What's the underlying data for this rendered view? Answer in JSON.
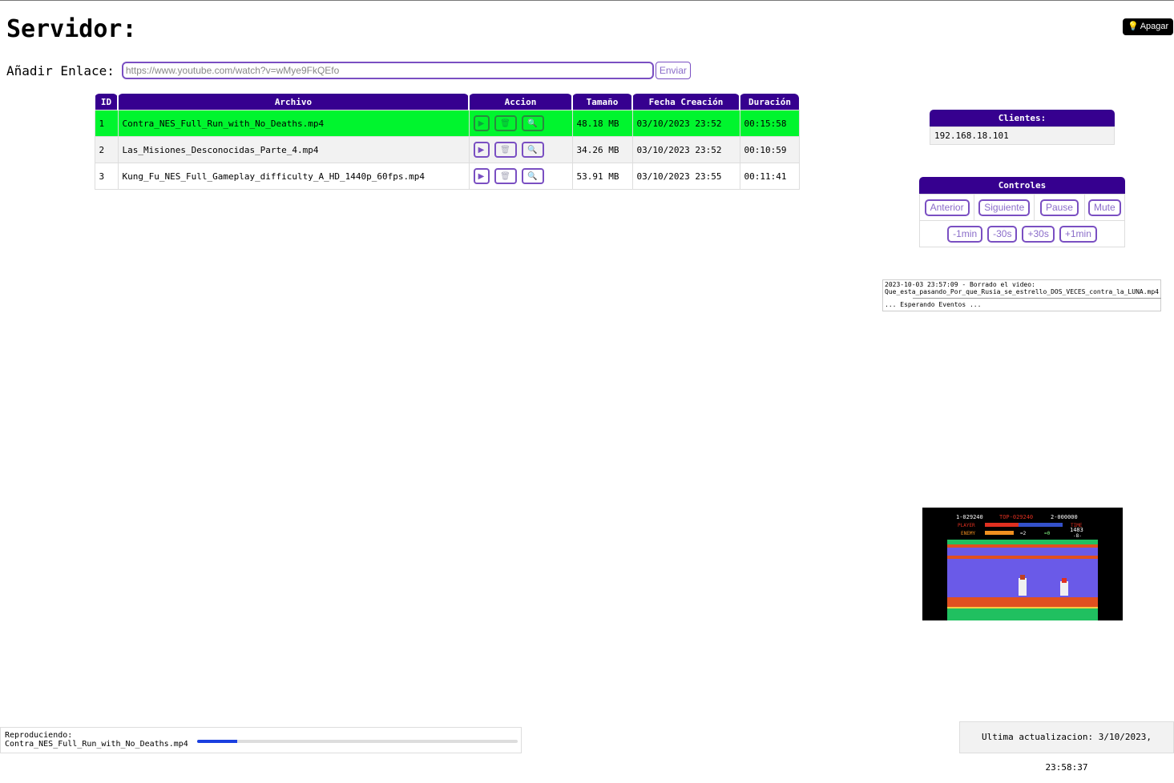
{
  "header": {
    "title": "Servidor:",
    "power_button": "Apagar",
    "power_icon": "lightbulb-icon"
  },
  "link_form": {
    "label": "Añadir Enlace:",
    "placeholder": "https://www.youtube.com/watch?v=wMye9FkQEfo",
    "submit_label": "Enviar"
  },
  "files_table": {
    "headers": [
      "ID",
      "Archivo",
      "Accion",
      "Tamaño",
      "Fecha Creación",
      "Duración"
    ],
    "rows": [
      {
        "id": "1",
        "file": "Contra_NES_Full_Run_with_No_Deaths.mp4",
        "size": "48.18 MB",
        "created": "03/10/2023 23:52",
        "duration": "00:15:58",
        "playing": true
      },
      {
        "id": "2",
        "file": "Las_Misiones_Desconocidas_Parte_4.mp4",
        "size": "34.26 MB",
        "created": "03/10/2023 23:52",
        "duration": "00:10:59",
        "playing": false
      },
      {
        "id": "3",
        "file": "Kung_Fu_NES_Full_Gameplay_difficulty_A_HD_1440p_60fps.mp4",
        "size": "53.91 MB",
        "created": "03/10/2023 23:55",
        "duration": "00:11:41",
        "playing": false
      }
    ],
    "action_icons": [
      "play-icon",
      "trash-icon",
      "magnifier-icon"
    ]
  },
  "clients": {
    "title": "Clientes:",
    "items": [
      "192.168.18.101"
    ]
  },
  "controls": {
    "title": "Controles",
    "row1": [
      "Anterior",
      "Siguiente",
      "Pause",
      "Mute"
    ],
    "row2": [
      "-1min",
      "-30s",
      "+30s",
      "+1min"
    ]
  },
  "log": {
    "entry_line1": "2023-10-03 23:57:09 - Borrado el video:",
    "entry_line2": "Que_esta_pasando_Por_que_Rusia_se_estrello_DOS_VECES_contra_la_LUNA.mp4",
    "waiting": "... Esperando Eventos ..."
  },
  "preview": {
    "hud": {
      "p1": "1-029240",
      "top": "TOP-029240",
      "p2": "2-000000",
      "player": "PLAYER",
      "enemy": "ENEMY",
      "time_label": "TIME",
      "time_value": "1483",
      "floor": "-8-",
      "lives": "=2",
      "dragons": "=0"
    }
  },
  "status": {
    "now_playing_label": "Reproduciendo:",
    "now_playing_file": "Contra_NES_Full_Run_with_No_Deaths.mp4",
    "progress": 0.125,
    "last_update": "Ultima actualizacion: 3/10/2023, 23:58:37"
  },
  "colors": {
    "header_bg": "#36008f",
    "active_row": "#00f52e",
    "accent": "#7a4fc2",
    "progress": "#1a3fe0"
  }
}
